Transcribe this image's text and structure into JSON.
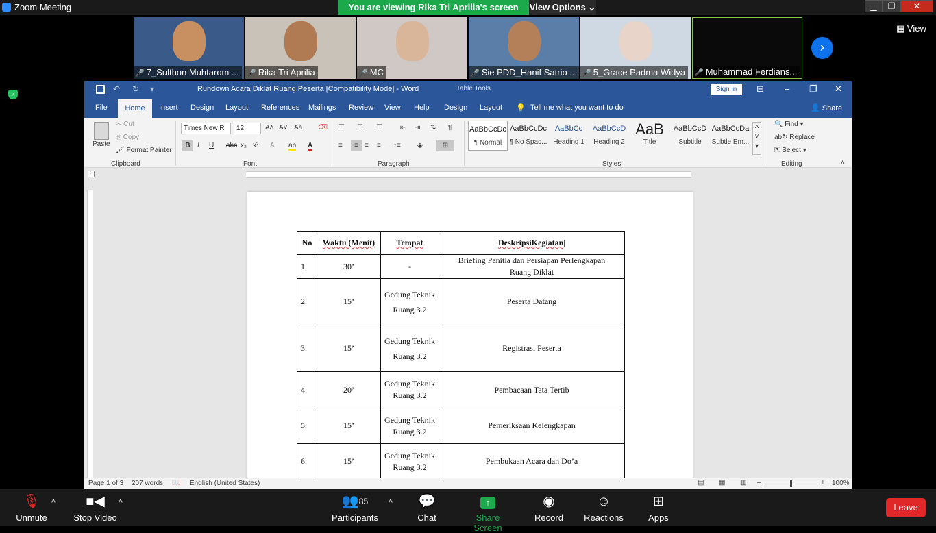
{
  "zoom": {
    "window_title": "Zoom Meeting",
    "banner": "You are viewing Rika Tri Aprilia's screen",
    "view_options": "View Options ⌄",
    "view_label": "View",
    "window_controls": [
      "▁",
      "❐",
      "✕"
    ]
  },
  "participants": [
    {
      "name": "7_Sulthon Muhtarom ...",
      "bg": "#3a5a8a",
      "face": "#c89060"
    },
    {
      "name": "Rika Tri Aprilia",
      "bg": "#c9c2b8",
      "face": "#b07a52"
    },
    {
      "name": "MC",
      "bg": "#cfc8c4",
      "face": "#d9b59a"
    },
    {
      "name": "Sie PDD_Hanif Satrio ...",
      "bg": "#5b7ea8",
      "face": "#b38059"
    },
    {
      "name": "5_Grace Padma Widya",
      "bg": "#cfd9e4",
      "face": "#e8d4c8"
    },
    {
      "name": "Muhammad Ferdians...",
      "bg": "#0a0a0a",
      "face": "#0a0a0a"
    }
  ],
  "word": {
    "title": "Rundown Acara Diklat Ruang Peserta [Compatibility Mode]  -  Word",
    "table_tools": "Table Tools",
    "sign_in": "Sign in",
    "controls": [
      "⊟",
      "–",
      "❐",
      "✕"
    ],
    "tabs": {
      "file": "File",
      "home": "Home",
      "insert": "Insert",
      "design": "Design",
      "layout": "Layout",
      "references": "References",
      "mailings": "Mailings",
      "review": "Review",
      "view": "View",
      "help": "Help",
      "design2": "Design",
      "layout2": "Layout",
      "tell_me": "Tell me what you want to do",
      "share": "Share"
    },
    "clipboard": {
      "paste": "Paste",
      "cut": "Cut",
      "copy": "Copy",
      "format_painter": "Format Painter",
      "label": "Clipboard"
    },
    "font": {
      "name": "Times New R",
      "size": "12",
      "label": "Font",
      "aa": "Aa"
    },
    "paragraph": {
      "label": "Paragraph"
    },
    "styles": {
      "label": "Styles",
      "items": [
        {
          "sample": "AaBbCcDc",
          "name": "¶ Normal"
        },
        {
          "sample": "AaBbCcDc",
          "name": "¶ No Spac..."
        },
        {
          "sample": "AaBbCc",
          "name": "Heading 1"
        },
        {
          "sample": "AaBbCcD",
          "name": "Heading 2"
        },
        {
          "sample": "AaB",
          "name": "Title"
        },
        {
          "sample": "AaBbCcD",
          "name": "Subtitle"
        },
        {
          "sample": "AaBbCcDa",
          "name": "Subtle Em..."
        }
      ]
    },
    "editing": {
      "find": "Find",
      "replace": "Replace",
      "select": "Select",
      "label": "Editing"
    },
    "status": {
      "page": "Page 1 of 3",
      "words": "207 words",
      "language": "English (United States)",
      "zoom": "100%"
    }
  },
  "table": {
    "headers": [
      "No",
      "Waktu (Menit)",
      "Tempat",
      "DeskripsiKegiatan"
    ],
    "rows": [
      [
        "1.",
        "30’",
        "-",
        "Briefing Panitia dan Persiapan Perlengkapan Ruang Diklat"
      ],
      [
        "2.",
        "15’",
        "Gedung Teknik Ruang 3.2",
        "Peserta Datang"
      ],
      [
        "3.",
        "15’",
        "Gedung Teknik Ruang 3.2",
        "Registrasi Peserta"
      ],
      [
        "4.",
        "20’",
        "Gedung Teknik Ruang 3.2",
        "Pembacaan Tata Tertib"
      ],
      [
        "5.",
        "15’",
        "Gedung Teknik Ruang 3.2",
        "Pemeriksaan Kelengkapan"
      ],
      [
        "6.",
        "15’",
        "Gedung Teknik Ruang 3.2",
        "Pembukaan Acara dan Do’a"
      ]
    ]
  },
  "toolbar": {
    "unmute": "Unmute",
    "stop_video": "Stop Video",
    "participants": "Participants",
    "participants_count": "85",
    "chat": "Chat",
    "share_screen": "Share Screen",
    "record": "Record",
    "reactions": "Reactions",
    "apps": "Apps",
    "leave": "Leave"
  }
}
